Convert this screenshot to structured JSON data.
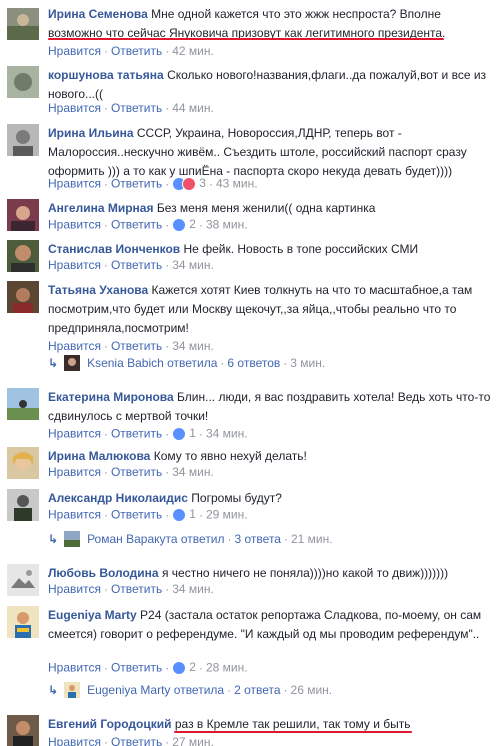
{
  "ui": {
    "like_label": "Нравится",
    "reply_label": "Ответить",
    "dot": "·",
    "replied_female": "ответила",
    "replied_male": "ответил"
  },
  "colors": {
    "link": "#365899",
    "meta": "#90949c",
    "highlight": "#e0182f"
  },
  "comments": [
    {
      "author": "Ирина Семенова",
      "text": "Мне одной кажется что это жжж неспроста? Вполне возможно что сейчас Януковича призовут как легитимного президента.",
      "reactions": "",
      "time": "42 мин."
    },
    {
      "author": "коршунова татьяна",
      "text": "Сколько нового!названия,флаги..да пожалуй,вот и все из нового...((",
      "reactions": "",
      "time": "44 мин."
    },
    {
      "author": "Ирина Ильина",
      "text": "СССР, Украина, Новороссия,ЛДНР, теперь вот - Малороссия..нескучно живём.. Съездить штоле, российский паспорт сразу оформить ))) а то как у шпиЁна - паспорта скоро некуда девать будет))))",
      "reactions": "3",
      "time": "43 мин."
    },
    {
      "author": "Ангелина Мирная",
      "text": "Без меня меня женили(( одна картинка",
      "reactions": "2",
      "time": "38 мин."
    },
    {
      "author": "Станислав Ионченков",
      "text": "Не фейк. Новость в топе российских СМИ",
      "reactions": "",
      "time": "34 мин."
    },
    {
      "author": "Татьяна Уханова",
      "text": "Кажется хотят Киев толкнуть на что то масштабное,а там посмотрим,что будет или Москву щекочут,,за яйца,,чтобы реально что то предприняла,посмотрим!",
      "reactions": "",
      "time": "34 мин.",
      "replies": {
        "name": "Ksenia Babich",
        "verb": "ответила",
        "count": "6 ответов",
        "time": "3 мин."
      }
    },
    {
      "author": "Екатерина Миронова",
      "text": "Блин... люди, я вас поздравить хотела! Ведь хоть что-то сдвинулось с мертвой точки!",
      "reactions": "1",
      "time": "34 мин."
    },
    {
      "author": "Ирина Малюкова",
      "text": "Кому то явно нехуй делать!",
      "reactions": "",
      "time": "34 мин."
    },
    {
      "author": "Александр Николаидис",
      "text": "Погромы будут?",
      "reactions": "1",
      "time": "29 мин.",
      "replies": {
        "name": "Роман Варакута",
        "verb": "ответил",
        "count": "3 ответа",
        "time": "21 мин."
      }
    },
    {
      "author": "Любовь Володина",
      "text": "я честно ничего не поняла))))но какой то движ)))))))",
      "reactions": "",
      "time": "34 мин."
    },
    {
      "author": "Eugeniya Marty",
      "text": "P24 (застала остаток репортажа Сладкова, по-моему, он сам смеется) говорит о референдуме. \"И каждый од мы проводим референдум\"..",
      "reactions": "2",
      "time": "28 мин.",
      "replies": {
        "name": "Eugeniya Marty",
        "verb": "ответила",
        "count": "2 ответа",
        "time": "26 мин."
      }
    },
    {
      "author": "Евгений Городоцкий",
      "text": "раз в Кремле так решили, так тому и быть",
      "reactions": "",
      "time": "27 мин."
    }
  ]
}
